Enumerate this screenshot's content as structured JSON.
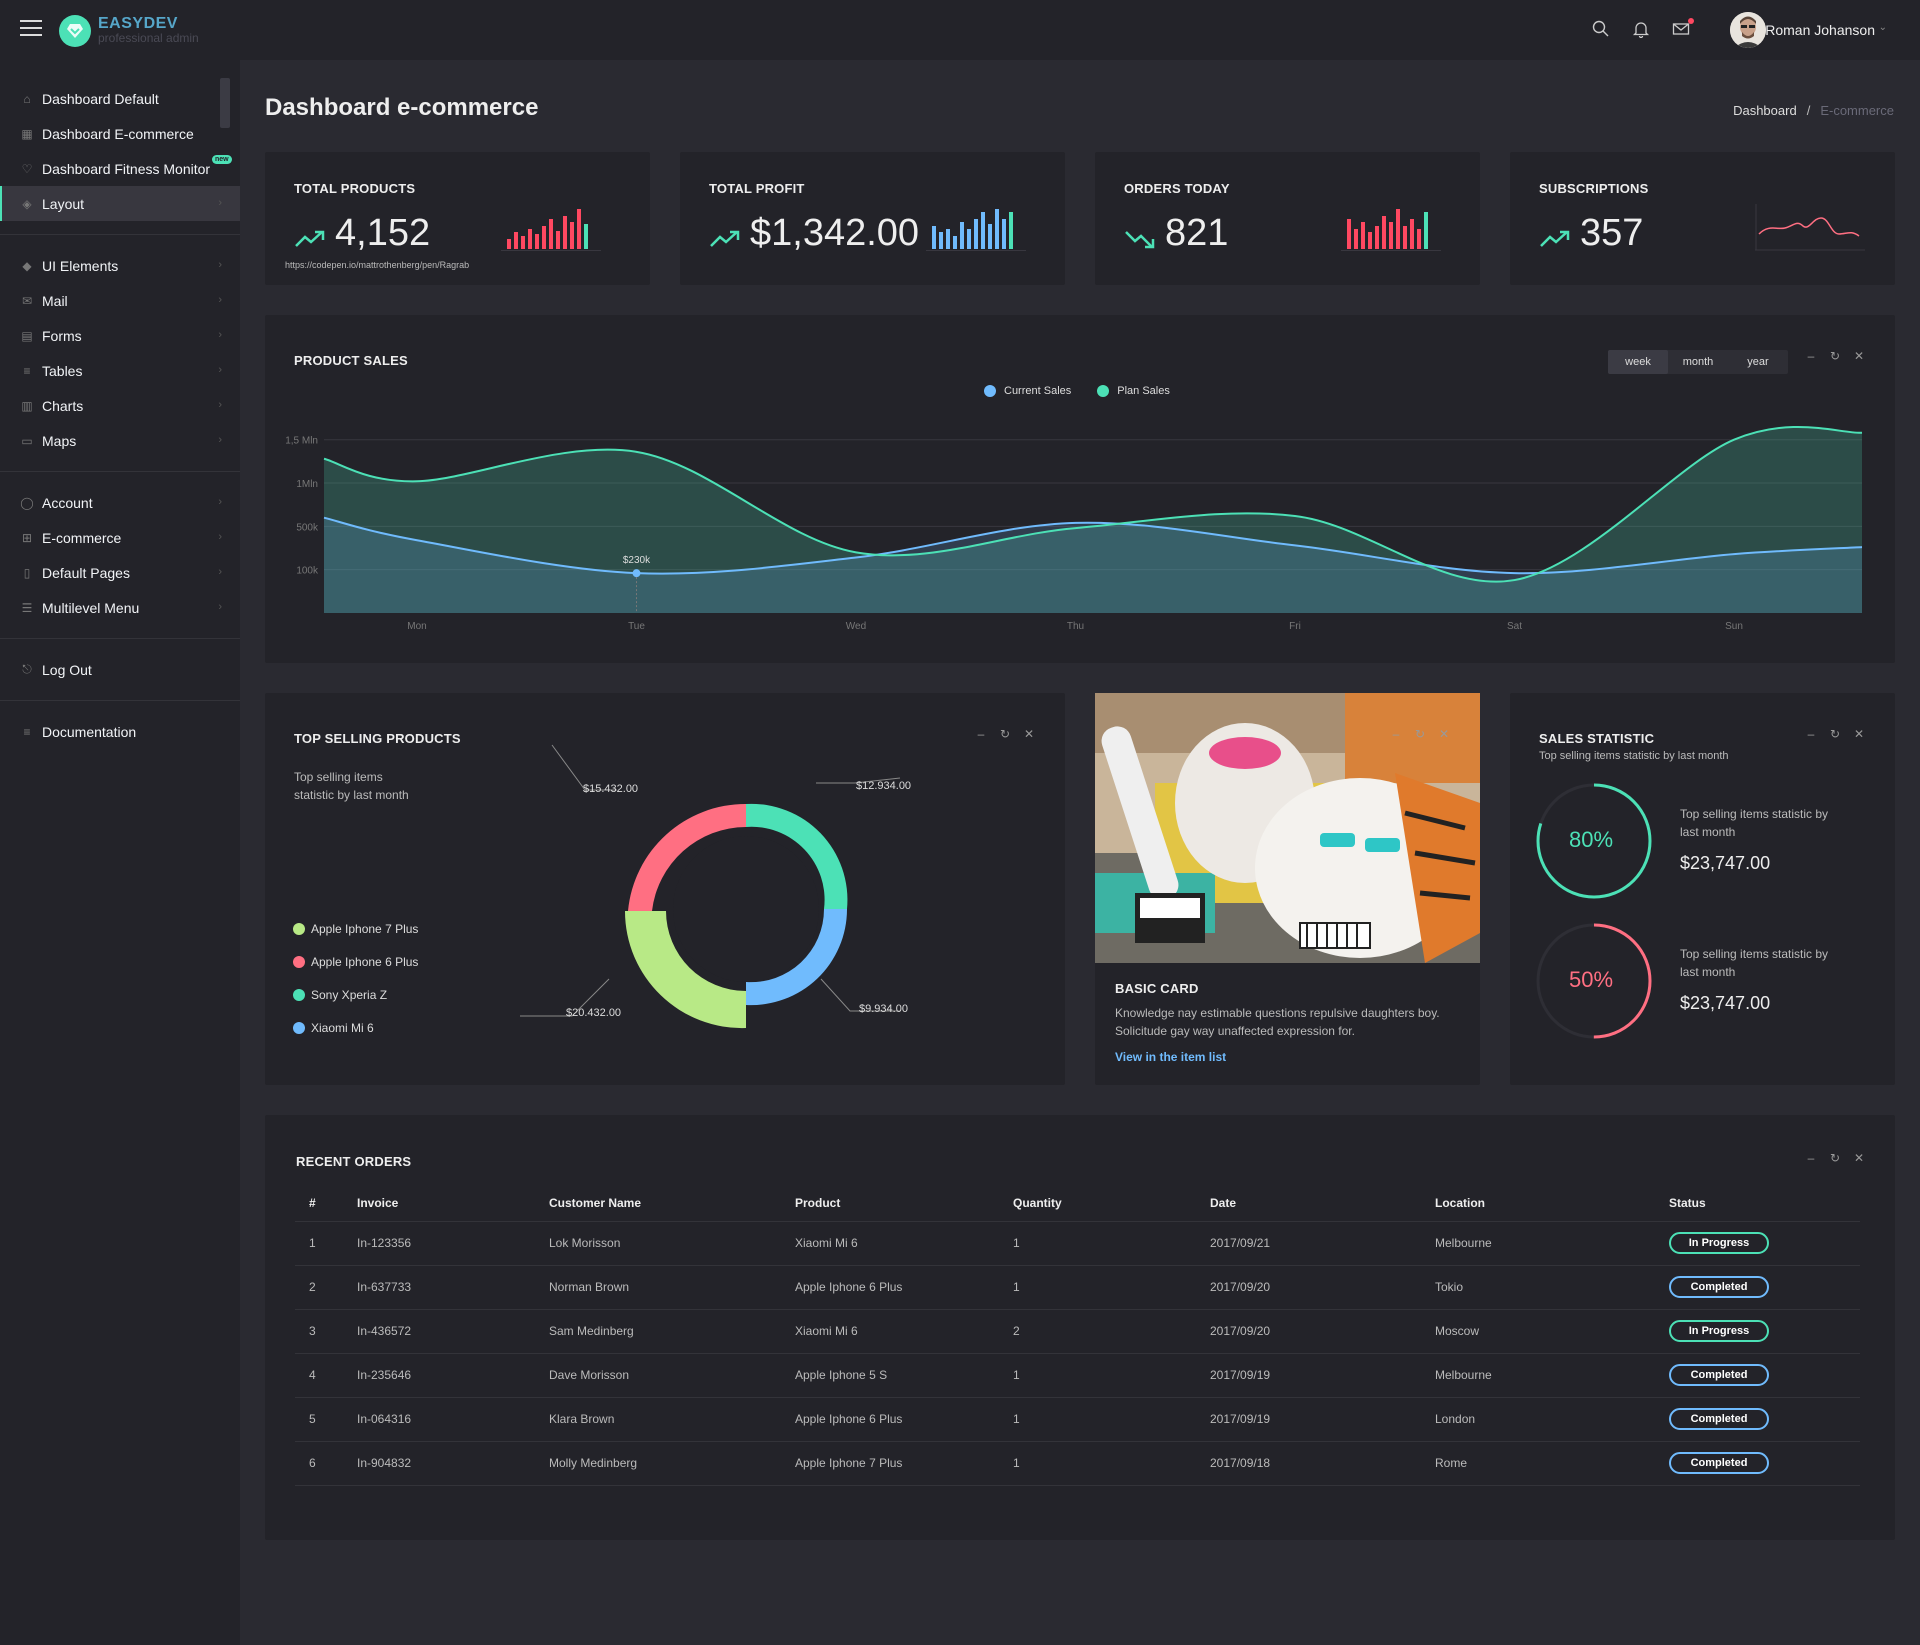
{
  "app": {
    "brand": "EASYDEV",
    "brand_sub": "professional admin",
    "user_name": "Roman Johanson"
  },
  "sidebar": {
    "group1": [
      {
        "label": "Dashboard Default",
        "icon": "home-icon"
      },
      {
        "label": "Dashboard E-commerce",
        "icon": "store-icon"
      },
      {
        "label": "Dashboard Fitness Monitor",
        "icon": "heart-icon",
        "badge": "new"
      },
      {
        "label": "Layout",
        "icon": "layers-icon",
        "active": true
      }
    ],
    "group2": [
      {
        "label": "UI Elements",
        "icon": "diamond-icon"
      },
      {
        "label": "Mail",
        "icon": "envelope-icon"
      },
      {
        "label": "Forms",
        "icon": "file-icon"
      },
      {
        "label": "Tables",
        "icon": "list-icon"
      },
      {
        "label": "Charts",
        "icon": "chart-bars-icon"
      },
      {
        "label": "Maps",
        "icon": "map-icon"
      }
    ],
    "group3": [
      {
        "label": "Account",
        "icon": "user-icon"
      },
      {
        "label": "E-commerce",
        "icon": "cart-icon"
      },
      {
        "label": "Default Pages",
        "icon": "file-empty-icon"
      },
      {
        "label": "Multilevel Menu",
        "icon": "menu-icon"
      }
    ],
    "logout": "Log Out",
    "documentation": "Documentation"
  },
  "page": {
    "title": "Dashboard e-commerce",
    "breadcrumb": [
      "Dashboard",
      "E-commerce"
    ]
  },
  "kpis": [
    {
      "title": "TOTAL PRODUCTS",
      "value": "4,152",
      "trend": "up",
      "link": "https://codepen.io/mattrothenberg/pen/Ragrab",
      "bars": [
        6,
        10,
        8,
        12,
        9,
        14,
        18,
        11,
        20,
        16,
        24,
        15
      ],
      "bar_color": "#ff4861"
    },
    {
      "title": "TOTAL PROFIT",
      "value": "$1,342.00",
      "trend": "up",
      "bars": [
        14,
        10,
        12,
        8,
        16,
        12,
        18,
        22,
        15,
        24,
        18,
        22
      ],
      "bar_color": "#70bbfd"
    },
    {
      "title": "ORDERS TODAY",
      "value": "821",
      "trend": "down",
      "bars": [
        18,
        12,
        16,
        10,
        14,
        20,
        16,
        24,
        14,
        18,
        12,
        22
      ],
      "bar_color": "#ff4861"
    },
    {
      "title": "SUBSCRIPTIONS",
      "value": "357",
      "trend": "up"
    }
  ],
  "colors": {
    "accent": "#4ce1b6",
    "blue": "#70bbfd",
    "red": "#ff4861",
    "lime": "#b8e986"
  },
  "product_sales": {
    "title": "PRODUCT SALES",
    "periods": [
      "week",
      "month",
      "year"
    ],
    "selected_period": "week",
    "tooltip": "$230k"
  },
  "chart_data": {
    "type": "area",
    "x": [
      "Mon",
      "Tue",
      "Wed",
      "Thu",
      "Fri",
      "Sat",
      "Sun"
    ],
    "ytick_labels": [
      "100k",
      "500k",
      "1Mln",
      "1,5 Mln"
    ],
    "series": [
      {
        "name": "Current Sales",
        "color": "#70bbfd",
        "values": [
          420,
          230,
          320,
          520,
          390,
          230,
          340
        ]
      },
      {
        "name": "Plan Sales",
        "color": "#4ce1b6",
        "values": [
          760,
          930,
          350,
          490,
          560,
          190,
          1000
        ]
      }
    ]
  },
  "top_selling": {
    "title": "TOP SELLING PRODUCTS",
    "description": "Top selling items statistic by last month",
    "items": [
      {
        "label": "Apple Iphone 7 Plus",
        "color": "#b8e986"
      },
      {
        "label": "Apple Iphone 6 Plus",
        "color": "#ff6f82"
      },
      {
        "label": "Sony Xperia Z",
        "color": "#4ce1b6"
      },
      {
        "label": "Xiaomi Mi 6",
        "color": "#70bbfd"
      }
    ],
    "donut_labels": {
      "top_left": "$15.432.00",
      "top_right": "$12.934.00",
      "bottom_right": "$9.934.00",
      "bottom_left": "$20.432.00"
    }
  },
  "basic_card": {
    "title": "BASIC CARD",
    "text": "Knowledge nay estimable questions repulsive daughters boy. Solicitude gay way unaffected expression for.",
    "link": "View in the item list"
  },
  "sales_statistic": {
    "title": "SALES STATISTIC",
    "subtitle": "Top selling items statistic by last month",
    "rings": [
      {
        "percent_label": "80%",
        "percent": 80,
        "color": "#4ce1b6",
        "label": "Top selling items statistic by last month",
        "amount": "$23,747.00"
      },
      {
        "percent_label": "50%",
        "percent": 50,
        "color": "#ff6f82",
        "label": "Top selling items statistic by last month",
        "amount": "$23,747.00"
      }
    ]
  },
  "orders": {
    "title": "RECENT ORDERS",
    "columns": [
      "#",
      "Invoice",
      "Customer Name",
      "Product",
      "Quantity",
      "Date",
      "Location",
      "Status"
    ],
    "rows": [
      [
        "1",
        "In-123356",
        "Lok Morisson",
        "Xiaomi Mi 6",
        "1",
        "2017/09/21",
        "Melbourne",
        "In Progress"
      ],
      [
        "2",
        "In-637733",
        "Norman Brown",
        "Apple Iphone 6 Plus",
        "1",
        "2017/09/20",
        "Tokio",
        "Completed"
      ],
      [
        "3",
        "In-436572",
        "Sam Medinberg",
        "Xiaomi Mi 6",
        "2",
        "2017/09/20",
        "Moscow",
        "In Progress"
      ],
      [
        "4",
        "In-235646",
        "Dave Morisson",
        "Apple Iphone 5 S",
        "1",
        "2017/09/19",
        "Melbourne",
        "Completed"
      ],
      [
        "5",
        "In-064316",
        "Klara Brown",
        "Apple Iphone 6 Plus",
        "1",
        "2017/09/19",
        "London",
        "Completed"
      ],
      [
        "6",
        "In-904832",
        "Molly Medinberg",
        "Apple Iphone 7 Plus",
        "1",
        "2017/09/18",
        "Rome",
        "Completed"
      ]
    ]
  }
}
